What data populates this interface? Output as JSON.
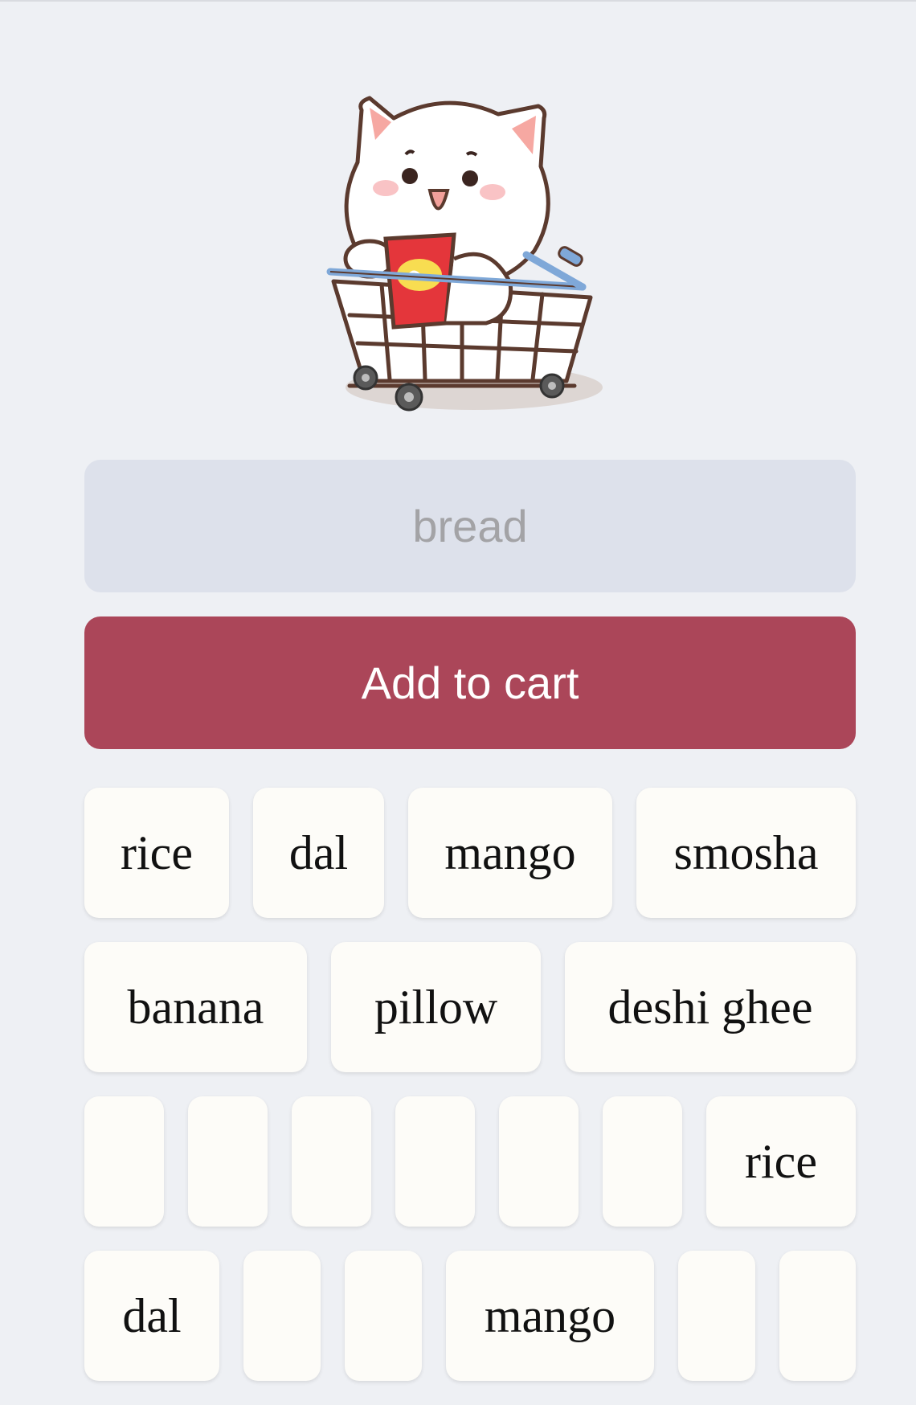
{
  "app": {
    "mascot_icon": "cat-in-shopping-cart-illustration"
  },
  "input": {
    "placeholder": "bread",
    "value": ""
  },
  "add_button": {
    "label": "Add to cart",
    "color": "#ab4659"
  },
  "chips": [
    [
      "rice",
      "dal",
      "mango",
      "smosha"
    ],
    [
      "banana",
      "pillow",
      "deshi ghee"
    ],
    [
      "",
      "",
      "",
      "",
      "",
      "",
      "rice"
    ],
    [
      "dal",
      "",
      "",
      "mango",
      "",
      ""
    ]
  ],
  "colors": {
    "background": "#eef0f4",
    "input_bg": "#dde1eb",
    "chip_bg": "#fdfcf8"
  }
}
